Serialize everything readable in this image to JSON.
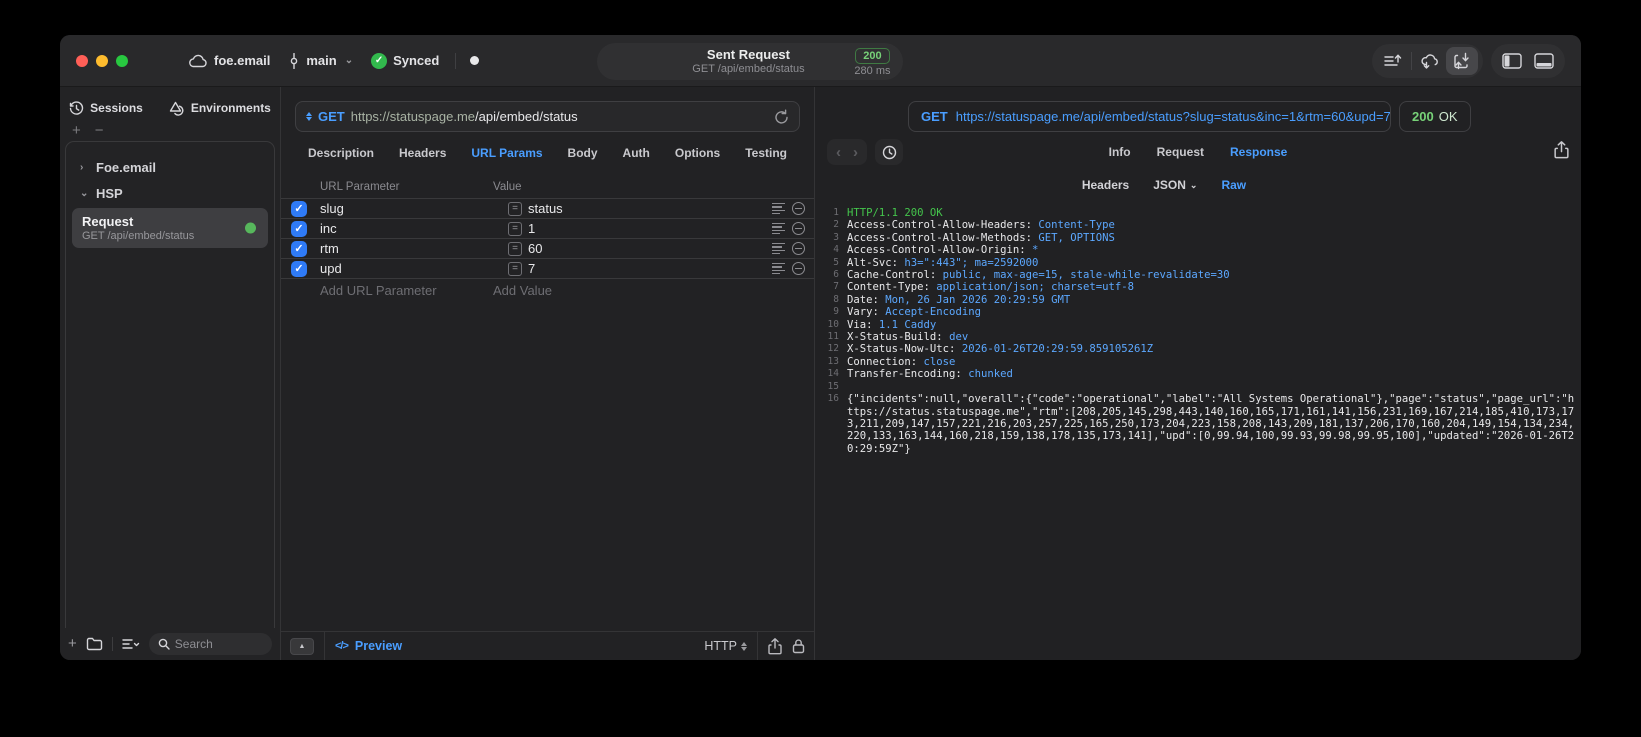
{
  "titlebar": {
    "project": "foe.email",
    "branch": "main",
    "sync_status": "Synced",
    "center": {
      "title": "Sent Request",
      "subtitle": "GET /api/embed/status",
      "status_code": "200",
      "duration": "280 ms"
    }
  },
  "sidebar": {
    "tabs": {
      "sessions": "Sessions",
      "environments": "Environments"
    },
    "tree": [
      {
        "label": "Foe.email",
        "chevron": "›"
      },
      {
        "label": "HSP",
        "chevron": "⌄"
      }
    ],
    "request_item": {
      "title": "Request",
      "subtitle": "GET /api/embed/status"
    },
    "search_placeholder": "Search"
  },
  "request_pane": {
    "method": "GET",
    "url_host": "https://statuspage.me",
    "url_path": "/api/embed/status",
    "tabs": [
      "Description",
      "Headers",
      "URL Params",
      "Body",
      "Auth",
      "Options",
      "Testing"
    ],
    "active_tab": "URL Params",
    "table": {
      "col_name": "URL Parameter",
      "col_value": "Value",
      "rows": [
        {
          "name": "slug",
          "value": "status",
          "enabled": true
        },
        {
          "name": "inc",
          "value": "1",
          "enabled": true
        },
        {
          "name": "rtm",
          "value": "60",
          "enabled": true
        },
        {
          "name": "upd",
          "value": "7",
          "enabled": true
        }
      ],
      "add_name_placeholder": "Add URL Parameter",
      "add_value_placeholder": "Add Value"
    },
    "footer": {
      "preview_label": "Preview",
      "code_glyph": "</>",
      "protocol": "HTTP"
    }
  },
  "response_pane": {
    "method": "GET",
    "url": "https://statuspage.me/api/embed/status?slug=status&inc=1&rtm=60&upd=7",
    "status_code": "200",
    "status_text": "OK",
    "tabs": [
      "Info",
      "Request",
      "Response"
    ],
    "active_tab": "Response",
    "subtabs": [
      "Headers",
      "JSON",
      "Raw"
    ],
    "active_subtab": "Raw",
    "dropdown_subtab": "JSON",
    "lines": [
      {
        "n": 1,
        "seg": [
          [
            "HTTP/1.1 200 OK",
            "green"
          ]
        ]
      },
      {
        "n": 2,
        "seg": [
          [
            "Access-Control-Allow-Headers: ",
            "white"
          ],
          [
            "Content-Type",
            "blue"
          ]
        ]
      },
      {
        "n": 3,
        "seg": [
          [
            "Access-Control-Allow-Methods: ",
            "white"
          ],
          [
            "GET, OPTIONS",
            "blue"
          ]
        ]
      },
      {
        "n": 4,
        "seg": [
          [
            "Access-Control-Allow-Origin: ",
            "white"
          ],
          [
            "*",
            "blue"
          ]
        ]
      },
      {
        "n": 5,
        "seg": [
          [
            "Alt-Svc: ",
            "white"
          ],
          [
            "h3=\":443\"; ma=2592000",
            "blue"
          ]
        ]
      },
      {
        "n": 6,
        "seg": [
          [
            "Cache-Control: ",
            "white"
          ],
          [
            "public, max-age=15, stale-while-revalidate=30",
            "blue"
          ]
        ]
      },
      {
        "n": 7,
        "seg": [
          [
            "Content-Type: ",
            "white"
          ],
          [
            "application/json; charset=utf-8",
            "blue"
          ]
        ]
      },
      {
        "n": 8,
        "seg": [
          [
            "Date: ",
            "white"
          ],
          [
            "Mon, 26 Jan 2026 20:29:59 GMT",
            "blue"
          ]
        ]
      },
      {
        "n": 9,
        "seg": [
          [
            "Vary: ",
            "white"
          ],
          [
            "Accept-Encoding",
            "blue"
          ]
        ]
      },
      {
        "n": 10,
        "seg": [
          [
            "Via: ",
            "white"
          ],
          [
            "1.1 Caddy",
            "blue"
          ]
        ]
      },
      {
        "n": 11,
        "seg": [
          [
            "X-Status-Build: ",
            "white"
          ],
          [
            "dev",
            "blue"
          ]
        ]
      },
      {
        "n": 12,
        "seg": [
          [
            "X-Status-Now-Utc: ",
            "white"
          ],
          [
            "2026-01-26T20:29:59.859105261Z",
            "blue"
          ]
        ]
      },
      {
        "n": 13,
        "seg": [
          [
            "Connection: ",
            "white"
          ],
          [
            "close",
            "blue"
          ]
        ]
      },
      {
        "n": 14,
        "seg": [
          [
            "Transfer-Encoding: ",
            "white"
          ],
          [
            "chunked",
            "blue"
          ]
        ]
      },
      {
        "n": 15,
        "seg": []
      },
      {
        "n": 16,
        "seg": [
          [
            "{\"incidents\":null,\"overall\":{\"code\":\"operational\",\"label\":\"All Systems Operational\"},\"page\":\"status\",\"page_url\":\"https://status.statuspage.me\",\"rtm\":[208,205,145,298,443,140,160,165,171,161,141,156,231,169,167,214,185,410,173,173,211,209,147,157,221,216,203,257,225,165,250,173,204,223,158,208,143,209,181,137,206,170,160,204,149,154,134,234,220,133,163,144,160,218,159,138,178,135,173,141],\"upd\":[0,99.94,100,99.93,99.98,99.95,100],\"updated\":\"2026-01-26T20:29:59Z\"}",
            "white"
          ]
        ]
      }
    ]
  },
  "colors": {
    "accent_blue": "#4a9eff",
    "status_green": "#77d178",
    "response_green": "#44c54c",
    "response_value_blue": "#5ca8ff"
  }
}
